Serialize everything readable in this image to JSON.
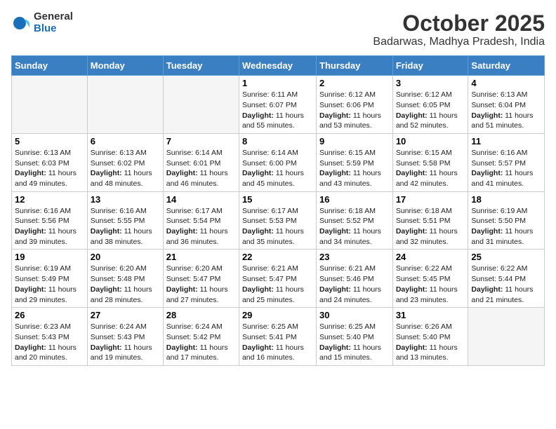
{
  "logo": {
    "general": "General",
    "blue": "Blue"
  },
  "title": "October 2025",
  "location": "Badarwas, Madhya Pradesh, India",
  "days_of_week": [
    "Sunday",
    "Monday",
    "Tuesday",
    "Wednesday",
    "Thursday",
    "Friday",
    "Saturday"
  ],
  "weeks": [
    [
      {
        "day": "",
        "info": ""
      },
      {
        "day": "",
        "info": ""
      },
      {
        "day": "",
        "info": ""
      },
      {
        "day": "1",
        "info": "Sunrise: 6:11 AM\nSunset: 6:07 PM\nDaylight: 11 hours and 55 minutes."
      },
      {
        "day": "2",
        "info": "Sunrise: 6:12 AM\nSunset: 6:06 PM\nDaylight: 11 hours and 53 minutes."
      },
      {
        "day": "3",
        "info": "Sunrise: 6:12 AM\nSunset: 6:05 PM\nDaylight: 11 hours and 52 minutes."
      },
      {
        "day": "4",
        "info": "Sunrise: 6:13 AM\nSunset: 6:04 PM\nDaylight: 11 hours and 51 minutes."
      }
    ],
    [
      {
        "day": "5",
        "info": "Sunrise: 6:13 AM\nSunset: 6:03 PM\nDaylight: 11 hours and 49 minutes."
      },
      {
        "day": "6",
        "info": "Sunrise: 6:13 AM\nSunset: 6:02 PM\nDaylight: 11 hours and 48 minutes."
      },
      {
        "day": "7",
        "info": "Sunrise: 6:14 AM\nSunset: 6:01 PM\nDaylight: 11 hours and 46 minutes."
      },
      {
        "day": "8",
        "info": "Sunrise: 6:14 AM\nSunset: 6:00 PM\nDaylight: 11 hours and 45 minutes."
      },
      {
        "day": "9",
        "info": "Sunrise: 6:15 AM\nSunset: 5:59 PM\nDaylight: 11 hours and 43 minutes."
      },
      {
        "day": "10",
        "info": "Sunrise: 6:15 AM\nSunset: 5:58 PM\nDaylight: 11 hours and 42 minutes."
      },
      {
        "day": "11",
        "info": "Sunrise: 6:16 AM\nSunset: 5:57 PM\nDaylight: 11 hours and 41 minutes."
      }
    ],
    [
      {
        "day": "12",
        "info": "Sunrise: 6:16 AM\nSunset: 5:56 PM\nDaylight: 11 hours and 39 minutes."
      },
      {
        "day": "13",
        "info": "Sunrise: 6:16 AM\nSunset: 5:55 PM\nDaylight: 11 hours and 38 minutes."
      },
      {
        "day": "14",
        "info": "Sunrise: 6:17 AM\nSunset: 5:54 PM\nDaylight: 11 hours and 36 minutes."
      },
      {
        "day": "15",
        "info": "Sunrise: 6:17 AM\nSunset: 5:53 PM\nDaylight: 11 hours and 35 minutes."
      },
      {
        "day": "16",
        "info": "Sunrise: 6:18 AM\nSunset: 5:52 PM\nDaylight: 11 hours and 34 minutes."
      },
      {
        "day": "17",
        "info": "Sunrise: 6:18 AM\nSunset: 5:51 PM\nDaylight: 11 hours and 32 minutes."
      },
      {
        "day": "18",
        "info": "Sunrise: 6:19 AM\nSunset: 5:50 PM\nDaylight: 11 hours and 31 minutes."
      }
    ],
    [
      {
        "day": "19",
        "info": "Sunrise: 6:19 AM\nSunset: 5:49 PM\nDaylight: 11 hours and 29 minutes."
      },
      {
        "day": "20",
        "info": "Sunrise: 6:20 AM\nSunset: 5:48 PM\nDaylight: 11 hours and 28 minutes."
      },
      {
        "day": "21",
        "info": "Sunrise: 6:20 AM\nSunset: 5:47 PM\nDaylight: 11 hours and 27 minutes."
      },
      {
        "day": "22",
        "info": "Sunrise: 6:21 AM\nSunset: 5:47 PM\nDaylight: 11 hours and 25 minutes."
      },
      {
        "day": "23",
        "info": "Sunrise: 6:21 AM\nSunset: 5:46 PM\nDaylight: 11 hours and 24 minutes."
      },
      {
        "day": "24",
        "info": "Sunrise: 6:22 AM\nSunset: 5:45 PM\nDaylight: 11 hours and 23 minutes."
      },
      {
        "day": "25",
        "info": "Sunrise: 6:22 AM\nSunset: 5:44 PM\nDaylight: 11 hours and 21 minutes."
      }
    ],
    [
      {
        "day": "26",
        "info": "Sunrise: 6:23 AM\nSunset: 5:43 PM\nDaylight: 11 hours and 20 minutes."
      },
      {
        "day": "27",
        "info": "Sunrise: 6:24 AM\nSunset: 5:43 PM\nDaylight: 11 hours and 19 minutes."
      },
      {
        "day": "28",
        "info": "Sunrise: 6:24 AM\nSunset: 5:42 PM\nDaylight: 11 hours and 17 minutes."
      },
      {
        "day": "29",
        "info": "Sunrise: 6:25 AM\nSunset: 5:41 PM\nDaylight: 11 hours and 16 minutes."
      },
      {
        "day": "30",
        "info": "Sunrise: 6:25 AM\nSunset: 5:40 PM\nDaylight: 11 hours and 15 minutes."
      },
      {
        "day": "31",
        "info": "Sunrise: 6:26 AM\nSunset: 5:40 PM\nDaylight: 11 hours and 13 minutes."
      },
      {
        "day": "",
        "info": ""
      }
    ]
  ]
}
